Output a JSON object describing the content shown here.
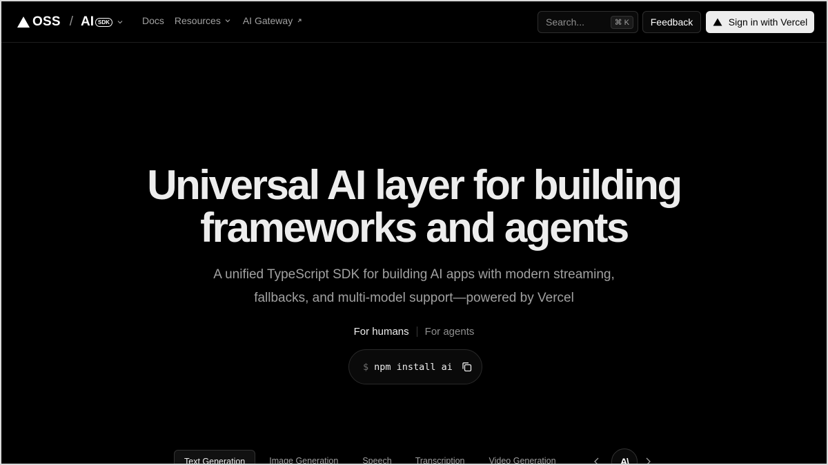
{
  "nav": {
    "brand": {
      "oss": "OSS",
      "slash": "/",
      "ai": "AI",
      "sdk": "SDK"
    },
    "links": [
      {
        "label": "Docs"
      },
      {
        "label": "Resources"
      },
      {
        "label": "AI Gateway"
      }
    ],
    "search": {
      "placeholder": "Search...",
      "shortcut_symbol": "⌘",
      "shortcut_key": "K"
    },
    "feedback_label": "Feedback",
    "signin_label": "Sign in with Vercel"
  },
  "hero": {
    "title_line1": "Universal AI layer for building",
    "title_line2": "frameworks and agents",
    "subtitle_line1": "A unified TypeScript SDK for building AI apps with modern streaming,",
    "subtitle_line2": "fallbacks, and multi-model support—powered by Vercel",
    "audience": {
      "humans": "For humans",
      "agents": "For agents",
      "selected": "For humans"
    },
    "install": {
      "prompt": "$",
      "command": "npm install ai"
    }
  },
  "tabs": [
    {
      "label": "Text Generation",
      "active": true
    },
    {
      "label": "Image Generation",
      "active": false
    },
    {
      "label": "Speech",
      "active": false
    },
    {
      "label": "Transcription",
      "active": false
    },
    {
      "label": "Video Generation",
      "active": false
    }
  ],
  "carousel": {
    "logo_text": "A\\"
  },
  "icons": [
    "vercel-triangle-icon",
    "chevron-down-icon",
    "arrow-up-right-icon",
    "copy-icon",
    "chevron-left-icon",
    "chevron-right-icon",
    "provider-logo-icon"
  ],
  "colors": {
    "background": "#000000",
    "text": "#ededed",
    "muted": "#a1a1a1",
    "button_light": "#ededed"
  }
}
